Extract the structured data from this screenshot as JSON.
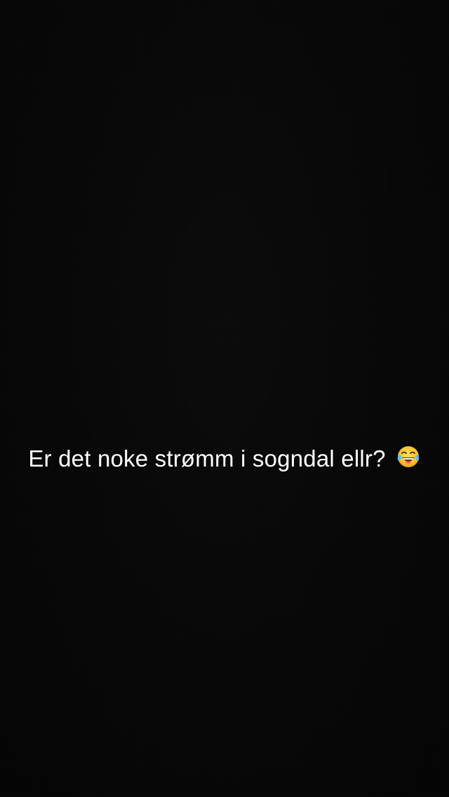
{
  "caption": {
    "text": "Er det noke strømm i sogndal ellr?",
    "emoji": "face-with-tears-of-joy-icon",
    "text_color": "#ffffff"
  },
  "background_color": "#050505"
}
